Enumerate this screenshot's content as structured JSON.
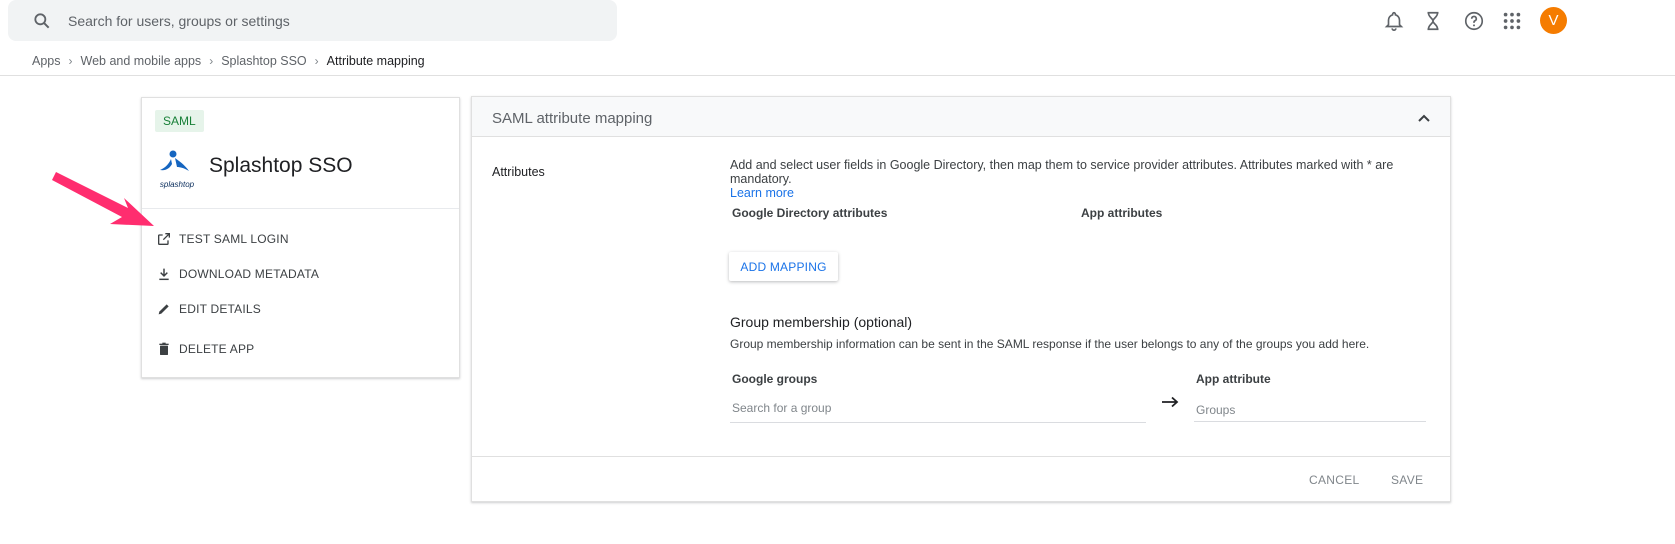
{
  "topbar": {
    "search_placeholder": "Search for users, groups or settings",
    "avatar_initial": "V",
    "avatar_color": "#f57c00"
  },
  "breadcrumb": [
    "Apps",
    "Web and mobile apps",
    "Splashtop SSO",
    "Attribute mapping"
  ],
  "app": {
    "type_badge": "SAML",
    "name": "Splashtop SSO",
    "logo_word": "splashtop",
    "actions": [
      "TEST SAML LOGIN",
      "DOWNLOAD METADATA",
      "EDIT DETAILS",
      "DELETE APP"
    ]
  },
  "panel": {
    "title": "SAML attribute mapping",
    "attributes_label": "Attributes",
    "description": "Add and select user fields in Google Directory, then map them to service provider attributes. Attributes marked with * are mandatory.",
    "learn_more": "Learn more",
    "col_directory": "Google Directory attributes",
    "col_app": "App attributes",
    "add_mapping": "ADD MAPPING",
    "group_title": "Group membership (optional)",
    "group_desc": "Group membership information can be sent in the SAML response if the user belongs to any of the groups you add here.",
    "google_groups_label": "Google groups",
    "google_groups_placeholder": "Search for a group",
    "app_attribute_label": "App attribute",
    "app_attribute_placeholder": "Groups",
    "cancel": "CANCEL",
    "save": "SAVE"
  },
  "colors": {
    "accent": "#1a73e8",
    "saml_badge_bg": "#e6f4ea",
    "saml_badge_text": "#188038",
    "annotation_arrow": "#ff2d6f"
  }
}
